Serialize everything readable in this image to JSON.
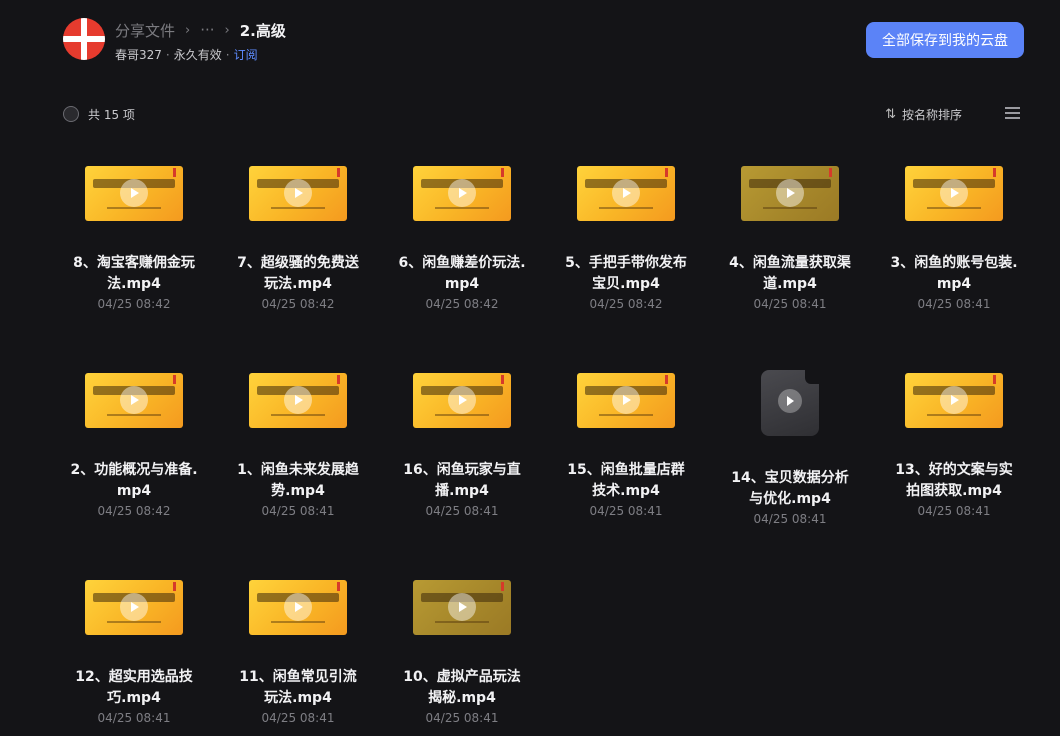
{
  "header": {
    "breadcrumb_root": "分享文件",
    "breadcrumb_sep": "›",
    "breadcrumb_ellipsis": "···",
    "breadcrumb_current": "2.高级",
    "owner": "春哥327",
    "meta_dot": "·",
    "validity": "永久有效",
    "subscribe": "订阅",
    "save_label": "全部保存到我的云盘"
  },
  "toolbar": {
    "count_label": "共 15 项",
    "sort_label": "按名称排序",
    "sort_icon": "⇅"
  },
  "files": [
    {
      "name": "8、淘宝客赚佣金玩法.mp4",
      "date": "04/25 08:42",
      "thumb": "video"
    },
    {
      "name": "7、超级骚的免费送玩法.mp4",
      "date": "04/25 08:42",
      "thumb": "video"
    },
    {
      "name": "6、闲鱼赚差价玩法.mp4",
      "date": "04/25 08:42",
      "thumb": "video"
    },
    {
      "name": "5、手把手带你发布宝贝.mp4",
      "date": "04/25 08:42",
      "thumb": "video"
    },
    {
      "name": "4、闲鱼流量获取渠道.mp4",
      "date": "04/25 08:41",
      "thumb": "video-dim"
    },
    {
      "name": "3、闲鱼的账号包装.mp4",
      "date": "04/25 08:41",
      "thumb": "video"
    },
    {
      "name": "2、功能概况与准备.mp4",
      "date": "04/25 08:42",
      "thumb": "video"
    },
    {
      "name": "1、闲鱼未来发展趋势.mp4",
      "date": "04/25 08:41",
      "thumb": "video"
    },
    {
      "name": "16、闲鱼玩家与直播.mp4",
      "date": "04/25 08:41",
      "thumb": "video"
    },
    {
      "name": "15、闲鱼批量店群技术.mp4",
      "date": "04/25 08:41",
      "thumb": "video"
    },
    {
      "name": "14、宝贝数据分析与优化.mp4",
      "date": "04/25 08:41",
      "thumb": "generic"
    },
    {
      "name": "13、好的文案与实拍图获取.mp4",
      "date": "04/25 08:41",
      "thumb": "video"
    },
    {
      "name": "12、超实用选品技巧.mp4",
      "date": "04/25 08:41",
      "thumb": "video"
    },
    {
      "name": "11、闲鱼常见引流玩法.mp4",
      "date": "04/25 08:41",
      "thumb": "video"
    },
    {
      "name": "10、虚拟产品玩法揭秘.mp4",
      "date": "04/25 08:41",
      "thumb": "video-dim"
    }
  ]
}
